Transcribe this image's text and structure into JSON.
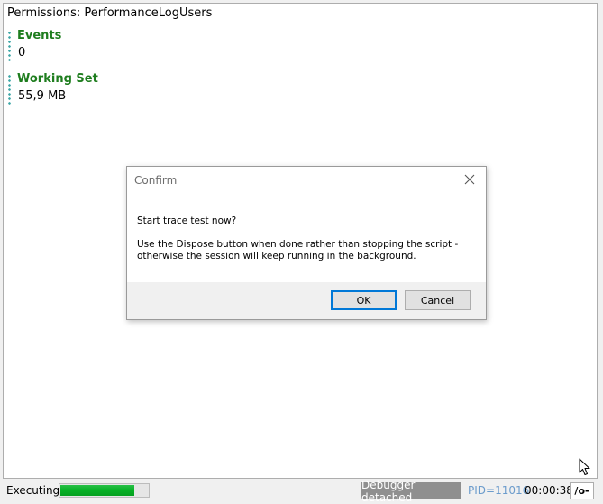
{
  "output": {
    "permissions_text": "Permissions: PerformanceLogUsers",
    "fields": [
      {
        "label": "Events",
        "value": "0"
      },
      {
        "label": "Working Set",
        "value": "55,9 MB"
      }
    ]
  },
  "dialog": {
    "title": "Confirm",
    "question": "Start trace test now?",
    "message": "Use the Dispose button when done rather than stopping the script - otherwise the session will keep running in the background.",
    "ok_label": "OK",
    "cancel_label": "Cancel"
  },
  "status": {
    "state": "Executing",
    "progress": 0.85,
    "debugger": "Debugger detached",
    "pid": "PID=11016",
    "time": "00:00:38",
    "toggle_label": "/o-"
  },
  "colors": {
    "label_green": "#1e7d1e",
    "progress_green": "#06b025",
    "pid_blue": "#6c9ccc"
  }
}
